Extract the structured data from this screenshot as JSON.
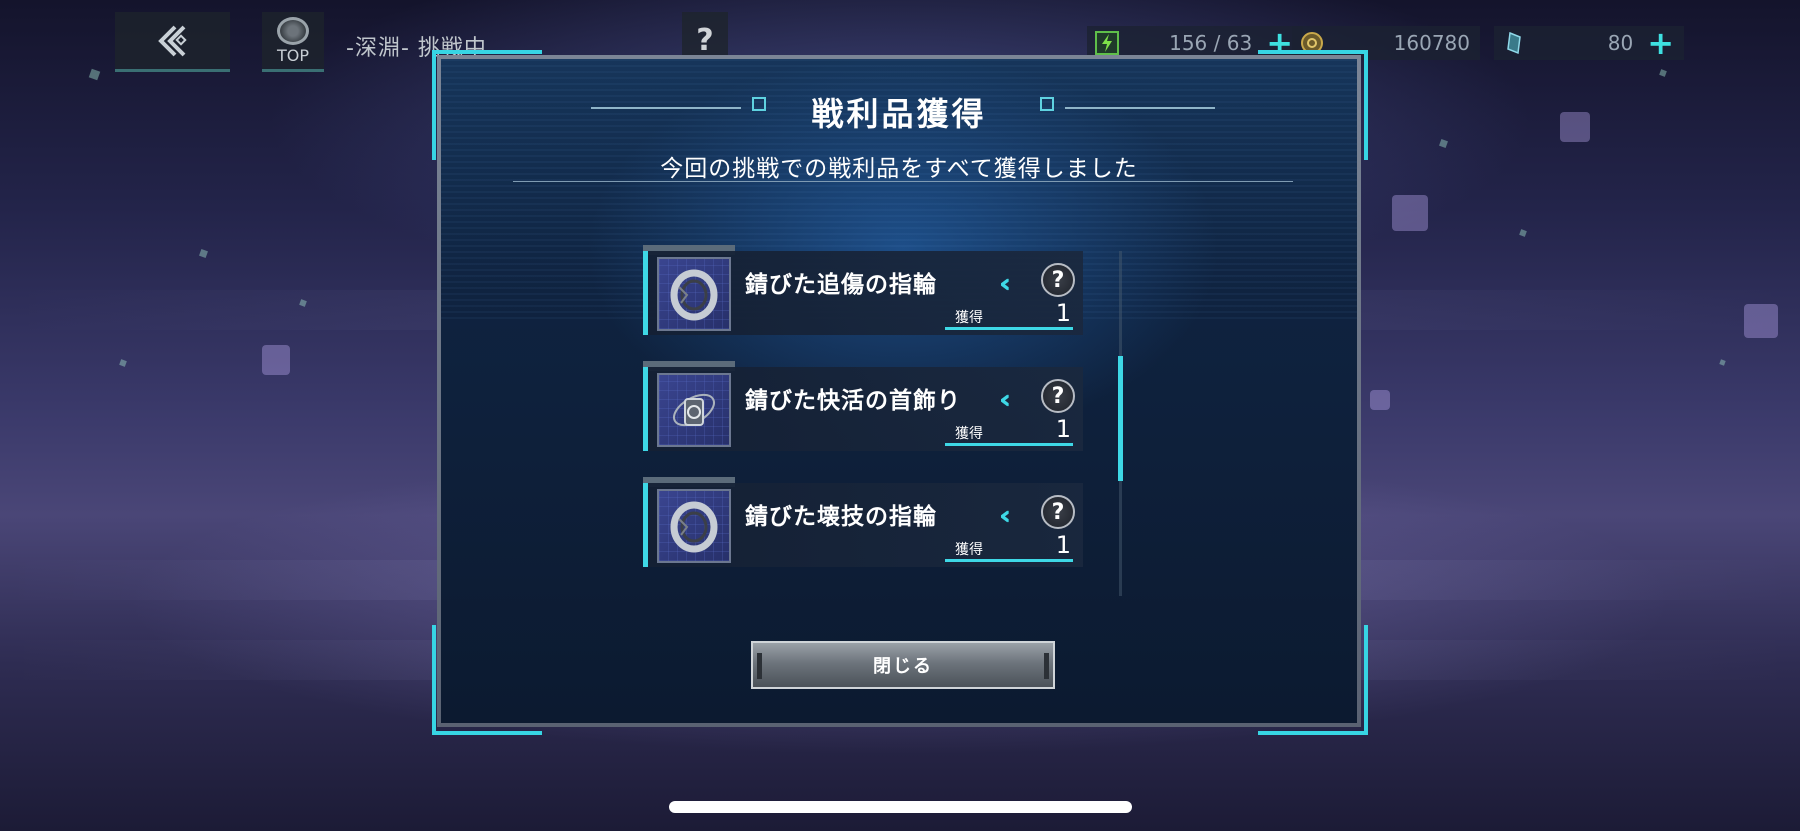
{
  "hud": {
    "top_label": "TOP",
    "stage_title": "-深淵- 挑戦中",
    "help_symbol": "?",
    "stamina": "156 / 63",
    "gold": "160780",
    "gems": "80",
    "plus": "+"
  },
  "modal": {
    "title": "戦利品獲得",
    "subtitle": "今回の挑戦での戦利品をすべて獲得しました",
    "items": [
      {
        "name": "錆びた追傷の指輪",
        "qty_label": "獲得",
        "qty": "1",
        "icon": "ring-icon"
      },
      {
        "name": "錆びた快活の首飾り",
        "qty_label": "獲得",
        "qty": "1",
        "icon": "necklace-icon"
      },
      {
        "name": "錆びた壊技の指輪",
        "qty_label": "獲得",
        "qty": "1",
        "icon": "ring-icon"
      }
    ],
    "help_symbol": "?",
    "chevron": "‹‹‹",
    "close_label": "閉じる"
  },
  "colors": {
    "accent": "#3ed8e6",
    "modal_bg": "#0f2340",
    "background": "#23244a"
  }
}
